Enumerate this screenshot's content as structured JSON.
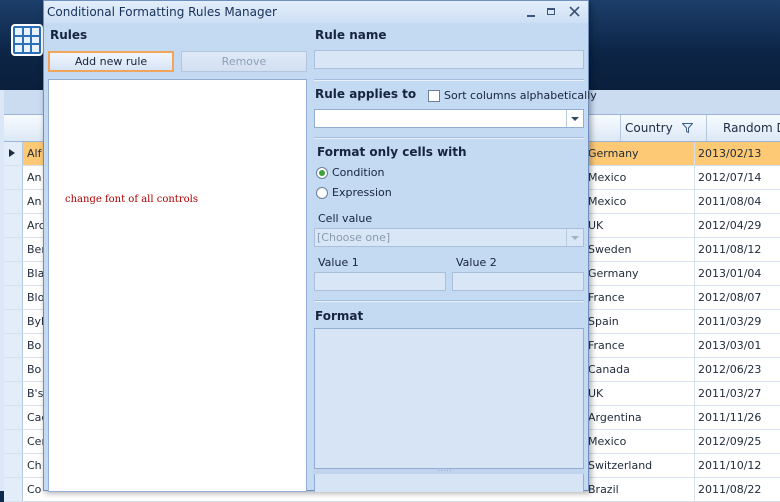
{
  "dialog": {
    "title": "Conditional Formatting Rules Manager",
    "rules_label": "Rules",
    "add_rule_label": "Add new rule",
    "remove_label": "Remove",
    "rule_items": [
      "change font of all controls"
    ],
    "rule_name_label": "Rule name",
    "rule_name_value": "",
    "rule_applies_label": "Rule applies to",
    "sort_columns_label": "Sort columns alphabetically",
    "sort_columns_checked": false,
    "applies_to_value": "",
    "format_only_label": "Format only cells with",
    "condition_label": "Condition",
    "condition_selected": true,
    "expression_label": "Expression",
    "cell_value_label": "Cell value",
    "cell_value_placeholder": "[Choose one]",
    "value1_label": "Value 1",
    "value2_label": "Value 2",
    "value1": "",
    "value2": "",
    "format_label": "Format",
    "grip_glyph": "·····"
  },
  "grid": {
    "columns": [
      "Country",
      "Random Dat"
    ],
    "rows": [
      {
        "name": "Alf",
        "country": "Germany",
        "date": "2013/02/13",
        "selected": true
      },
      {
        "name": "An",
        "country": "Mexico",
        "date": "2012/07/14"
      },
      {
        "name": "An",
        "country": "Mexico",
        "date": "2011/08/04"
      },
      {
        "name": "Arc",
        "country": "UK",
        "date": "2012/04/29"
      },
      {
        "name": "Ber",
        "country": "Sweden",
        "date": "2011/08/12"
      },
      {
        "name": "Bla",
        "country": "Germany",
        "date": "2013/01/04"
      },
      {
        "name": "Blo",
        "country": "France",
        "date": "2012/08/07"
      },
      {
        "name": "Byl",
        "country": "Spain",
        "date": "2011/03/29"
      },
      {
        "name": "Bo",
        "country": "France",
        "date": "2013/03/01"
      },
      {
        "name": "Bo",
        "country": "Canada",
        "date": "2012/06/23"
      },
      {
        "name": "B's",
        "country": "UK",
        "date": "2011/03/27"
      },
      {
        "name": "Cac",
        "country": "Argentina",
        "date": "2011/11/26"
      },
      {
        "name": "Cer",
        "country": "Mexico",
        "date": "2012/09/25"
      },
      {
        "name": "Ch",
        "country": "Switzerland",
        "date": "2011/10/12"
      },
      {
        "name": "Co",
        "country": "Brazil",
        "date": "2011/08/22"
      }
    ]
  },
  "colors": {
    "dialog_bg": "#c4d9f2",
    "selected_row": "#fdc975",
    "rule_text": "#b00000",
    "radio_on": "#3aa33a",
    "button_focus": "#f0a55a"
  },
  "icons": [
    "app-grid-icon",
    "filter-icon",
    "minimize-icon",
    "maximize-icon",
    "close-icon",
    "row-indicator-arrow-icon",
    "dropdown-arrow-icon"
  ]
}
